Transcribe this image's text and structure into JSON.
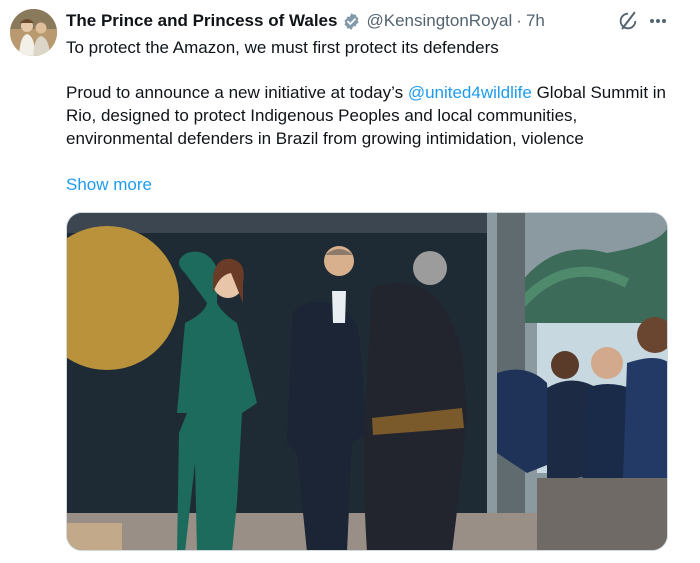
{
  "tweet": {
    "author_name": "The Prince and Princess of Wales",
    "handle": "@KensingtonRoyal",
    "separator": "·",
    "time": "7h",
    "text_line1": "To protect the Amazon, we must first protect its defenders",
    "text_before_mention": "Proud to announce a new initiative at today’s ",
    "mention": "@united4wildlife",
    "text_after_mention": "  Global Summit in Rio, designed to protect Indigenous Peoples and local communities, environmental defenders in Brazil from growing intimidation, violence",
    "show_more": "Show more"
  },
  "icons": {
    "verified": "verified-badge-icon",
    "grok": "grok-icon",
    "more": "more-options-icon"
  },
  "colors": {
    "link": "#1d9bf0",
    "secondary_text": "#536471",
    "text": "#0f1419"
  }
}
